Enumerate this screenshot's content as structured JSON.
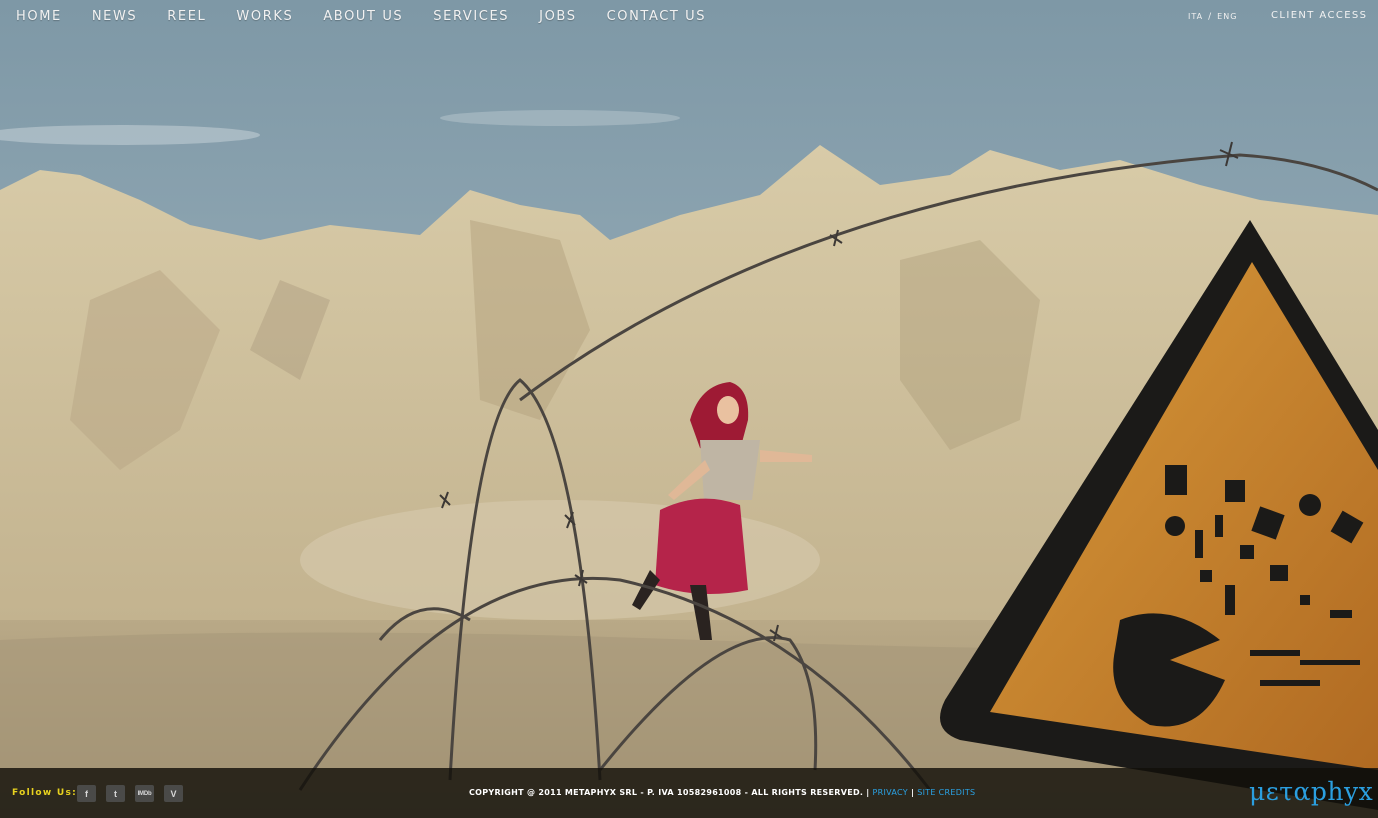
{
  "nav": {
    "items": [
      {
        "label": "HOME"
      },
      {
        "label": "NEWS"
      },
      {
        "label": "REEL"
      },
      {
        "label": "WORKS"
      },
      {
        "label": "ABOUT US"
      },
      {
        "label": "SERVICES"
      },
      {
        "label": "JOBS"
      },
      {
        "label": "CONTACT US"
      }
    ],
    "lang_ita": "ITA",
    "lang_sep": "/",
    "lang_eng": "ENG",
    "client_access": "CLIENT ACCESS"
  },
  "footer": {
    "follow_label": "Follow Us:",
    "social": [
      {
        "icon": "facebook-icon",
        "glyph": "f"
      },
      {
        "icon": "twitter-icon",
        "glyph": "t"
      },
      {
        "icon": "imdb-icon",
        "glyph": "IMDb"
      },
      {
        "icon": "vimeo-icon",
        "glyph": "V"
      }
    ],
    "copyright": "COPYRIGHT @ 2011 METAPHYX SRL - P. IVA 10582961008 - ALL RIGHTS RESERVED.",
    "sep": "|",
    "privacy": "PRIVACY",
    "site_credits": "SITE CREDITS",
    "logo": "μεταphyx"
  },
  "colors": {
    "follow": "#e8d21f",
    "link": "#2aa3e6",
    "logo": "#2b9fe0"
  }
}
